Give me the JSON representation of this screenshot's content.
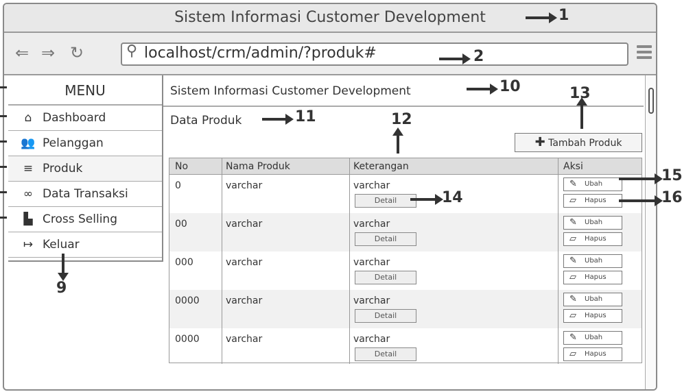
{
  "window": {
    "title": "Sistem Informasi Customer Development"
  },
  "browser": {
    "back_icon": "left-arrow-icon",
    "forward_icon": "right-arrow-icon",
    "reload_icon": "reload-icon",
    "url": "localhost/crm/admin/?produk#",
    "search_icon": "search-icon",
    "menu_icon": "hamburger-icon"
  },
  "sidebar": {
    "heading": "MENU",
    "items": [
      {
        "label": "Dashboard",
        "icon": "home-icon",
        "glyph": "⌂"
      },
      {
        "label": "Pelanggan",
        "icon": "users-icon",
        "glyph": "👥"
      },
      {
        "label": "Produk",
        "icon": "list-icon",
        "glyph": "≡"
      },
      {
        "label": "Data Transaksi",
        "icon": "link-icon",
        "glyph": "∞"
      },
      {
        "label": "Cross Selling",
        "icon": "file-icon",
        "glyph": "▙"
      },
      {
        "label": "Keluar",
        "icon": "logout-icon",
        "glyph": "↦"
      }
    ],
    "active_index": 2
  },
  "content": {
    "header": "Sistem Informasi Customer Development",
    "section_title": "Data Produk",
    "add_button": "Tambah Produk",
    "table": {
      "columns": [
        "No",
        "Nama Produk",
        "Keterangan",
        "Aksi"
      ],
      "rows": [
        {
          "no": "0",
          "nama": "varchar",
          "keterangan": "varchar"
        },
        {
          "no": "00",
          "nama": "varchar",
          "keterangan": "varchar"
        },
        {
          "no": "000",
          "nama": "varchar",
          "keterangan": "varchar"
        },
        {
          "no": "0000",
          "nama": "varchar",
          "keterangan": "varchar"
        },
        {
          "no": "0000",
          "nama": "varchar",
          "keterangan": "varchar"
        }
      ],
      "detail_label": "Detail",
      "edit_label": "Ubah",
      "delete_label": "Hapus"
    }
  },
  "annotations": {
    "n1": "1",
    "n2": "2",
    "n9": "9",
    "n10": "10",
    "n11": "11",
    "n12": "12",
    "n13": "13",
    "n14": "14",
    "n15": "15",
    "n16": "16"
  }
}
